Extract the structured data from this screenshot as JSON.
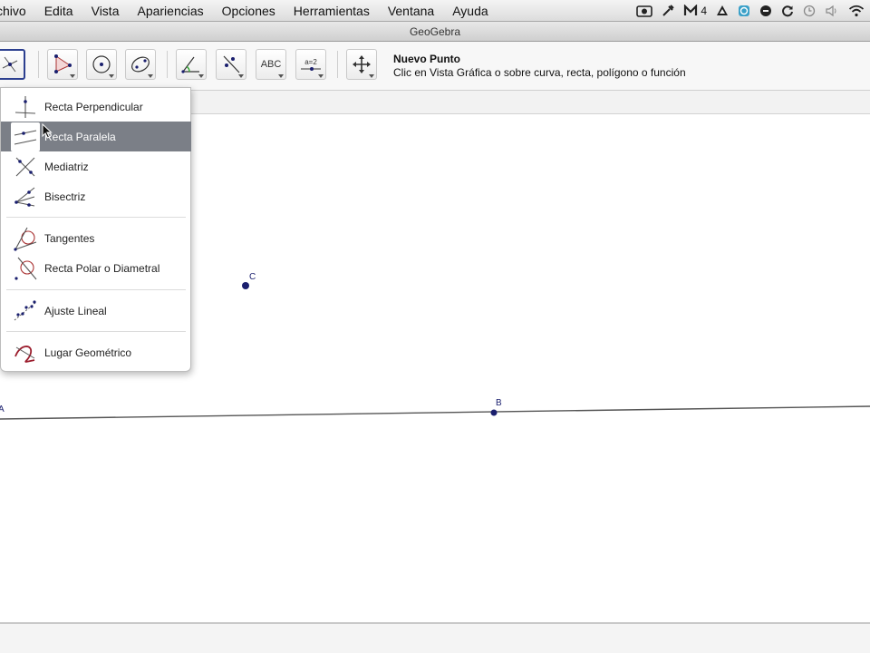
{
  "menubar": {
    "items": [
      "chivo",
      "Edita",
      "Vista",
      "Apariencias",
      "Opciones",
      "Herramientas",
      "Ventana",
      "Ayuda"
    ],
    "status_icons": [
      "camera-icon",
      "tools-icon",
      "mail-m-icon",
      "drive-icon",
      "clock-badge-icon",
      "record-icon",
      "sync-icon",
      "time-machine-icon",
      "wifi-icon"
    ],
    "mail_count": "4"
  },
  "window": {
    "title": "GeoGebra"
  },
  "toolbar": {
    "tools": [
      "move-tool-icon",
      "polygon-tool-icon",
      "circle-tool-icon",
      "conic-tool-icon",
      "angle-tool-icon",
      "reflect-tool-icon",
      "text-tool-icon",
      "slider-tool-icon",
      "move-graphics-tool-icon"
    ],
    "text_tool_label": "ABC",
    "slider_tool_label": "a=2",
    "help_title": "Nuevo Punto",
    "help_text": "Clic en Vista Gráfica o sobre curva, recta, polígono o función"
  },
  "dropdown": {
    "items": [
      {
        "label": "Recta Perpendicular",
        "icon": "perpendicular-line-icon"
      },
      {
        "label": "Recta Paralela",
        "icon": "parallel-line-icon",
        "selected": true
      },
      {
        "label": "Mediatriz",
        "icon": "perpendicular-bisector-icon"
      },
      {
        "label": "Bisectriz",
        "icon": "angle-bisector-icon"
      },
      {
        "label": "Tangentes",
        "icon": "tangents-icon"
      },
      {
        "label": "Recta Polar o Diametral",
        "icon": "polar-line-icon"
      },
      {
        "label": "Ajuste Lineal",
        "icon": "best-fit-line-icon"
      },
      {
        "label": "Lugar Geométrico",
        "icon": "locus-icon"
      }
    ]
  },
  "graphics": {
    "points": [
      {
        "label": "C"
      },
      {
        "label": "B"
      },
      {
        "label": "A"
      }
    ],
    "colors": {
      "point": "#1a1f6e",
      "line": "#555555",
      "selection": "#7b7f87"
    }
  }
}
